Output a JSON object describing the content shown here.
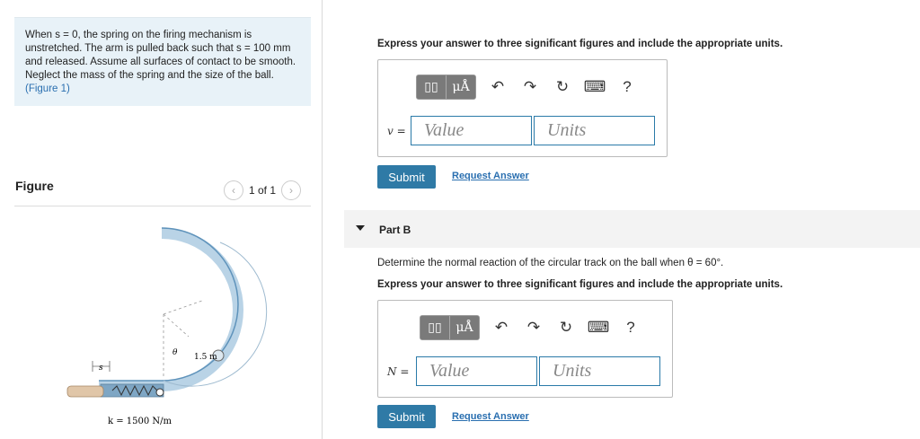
{
  "problem": {
    "text": "When s = 0, the spring on the firing mechanism is unstretched. The arm is pulled back such that s = 100 mm and released. Assume all surfaces of contact to be smooth. Neglect the mass of the spring and the size of the ball.",
    "figure_link": "(Figure 1)"
  },
  "figure": {
    "title": "Figure",
    "pager": "1 of 1",
    "labels": {
      "s": "s",
      "theta": "θ",
      "radius": "1.5 m",
      "k": "k = 1500 N/m"
    }
  },
  "part_a": {
    "instruction": "Express your answer to three significant figures and include the appropriate units.",
    "var_label": "v =",
    "value_placeholder": "Value",
    "units_placeholder": "Units",
    "submit": "Submit",
    "request": "Request Answer"
  },
  "part_b": {
    "title": "Part B",
    "question": "Determine the normal reaction of the circular track on the ball when θ = 60°.",
    "instruction": "Express your answer to three significant figures and include the appropriate units.",
    "var_label": "N =",
    "value_placeholder": "Value",
    "units_placeholder": "Units",
    "submit": "Submit",
    "request": "Request Answer"
  },
  "toolbar": {
    "template": "▯▯",
    "units": "μÅ",
    "undo": "↶",
    "redo": "↷",
    "reset": "↻",
    "keyboard": "⌨",
    "help": "?"
  },
  "icons": [
    "template-icon",
    "units-icon",
    "undo-icon",
    "redo-icon",
    "reset-icon",
    "keyboard-icon",
    "help-icon"
  ]
}
